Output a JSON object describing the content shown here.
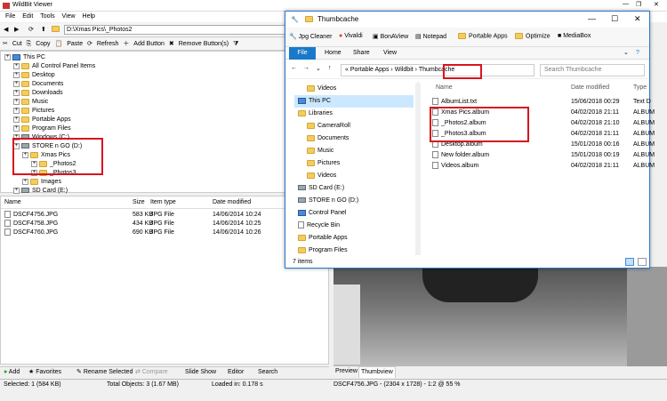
{
  "wildbit": {
    "title": "WildBit Viewer",
    "menu": [
      "File",
      "Edit",
      "Tools",
      "View",
      "Help"
    ],
    "address": "D:\\Xmas Pics\\_Photos2",
    "toolbar": [
      "Cut",
      "Copy",
      "Paste",
      "Refresh",
      "Add Button",
      "Remove Button(s)"
    ],
    "tree": [
      {
        "label": "This PC",
        "indent": 0,
        "icon": "pc"
      },
      {
        "label": "All Control Panel Items",
        "indent": 1,
        "icon": "folder"
      },
      {
        "label": "Desktop",
        "indent": 1,
        "icon": "folder"
      },
      {
        "label": "Documents",
        "indent": 1,
        "icon": "folder"
      },
      {
        "label": "Downloads",
        "indent": 1,
        "icon": "folder"
      },
      {
        "label": "Music",
        "indent": 1,
        "icon": "folder"
      },
      {
        "label": "Pictures",
        "indent": 1,
        "icon": "folder"
      },
      {
        "label": "Portable Apps",
        "indent": 1,
        "icon": "folder"
      },
      {
        "label": "Program Files",
        "indent": 1,
        "icon": "folder"
      },
      {
        "label": "Windows (C:)",
        "indent": 1,
        "icon": "drive"
      },
      {
        "label": "STORE n GO (D:)",
        "indent": 1,
        "icon": "drive"
      },
      {
        "label": "Xmas Pics",
        "indent": 2,
        "icon": "folder"
      },
      {
        "label": "_Photos2",
        "indent": 3,
        "icon": "folder"
      },
      {
        "label": "_Photos3",
        "indent": 3,
        "icon": "folder"
      },
      {
        "label": "Images",
        "indent": 2,
        "icon": "folder"
      },
      {
        "label": "SD Card (E:)",
        "indent": 1,
        "icon": "drive"
      }
    ],
    "columns": [
      "Name",
      "Size",
      "Item type",
      "Date modified"
    ],
    "files": [
      {
        "name": "DSCF4756.JPG",
        "size": "583 KB",
        "type": "JPG File",
        "date": "14/06/2014 10:24"
      },
      {
        "name": "DSCF4758.JPG",
        "size": "434 KB",
        "type": "JPG File",
        "date": "14/06/2014 10:25"
      },
      {
        "name": "DSCF4760.JPG",
        "size": "690 KB",
        "type": "JPG File",
        "date": "14/06/2014 10:26"
      }
    ],
    "bottom_buttons": [
      "Add",
      "Favorites",
      "Rename Selected",
      "Compare",
      "Slide Show",
      "Editor",
      "Search"
    ],
    "preview_tabs": [
      "Preview",
      "Thumbview"
    ],
    "status": {
      "selected": "Selected: 1 (584 KB)",
      "total": "Total Objects: 3 (1.67 MB)",
      "loaded": "Loaded in: 0.178 s",
      "image_info": "DSCF4756.JPG - (2304 x 1728) - 1:2 @ 55 %"
    }
  },
  "explorer": {
    "title": "Thumbcache",
    "favorites": [
      "Jpg Cleaner",
      "Vivaldi",
      "BonAView",
      "Notepad",
      "Portable Apps",
      "Optimize",
      "MediaBox"
    ],
    "tabs": [
      "File",
      "Home",
      "Share",
      "View"
    ],
    "breadcrumb": [
      "Portable Apps",
      "Wildbit",
      "Thumbcache"
    ],
    "search_placeholder": "Search Thumbcache",
    "nav": [
      {
        "label": "Videos",
        "indent": 1
      },
      {
        "label": "This PC",
        "indent": 0
      },
      {
        "label": "Libraries",
        "indent": 0
      },
      {
        "label": "CameraRoll",
        "indent": 1
      },
      {
        "label": "Documents",
        "indent": 1
      },
      {
        "label": "Music",
        "indent": 1
      },
      {
        "label": "Pictures",
        "indent": 1
      },
      {
        "label": "Videos",
        "indent": 1
      },
      {
        "label": "SD Card (E:)",
        "indent": 0
      },
      {
        "label": "STORE n GO (D:)",
        "indent": 0
      },
      {
        "label": "Control Panel",
        "indent": 0
      },
      {
        "label": "Recycle Bin",
        "indent": 0
      },
      {
        "label": "Portable Apps",
        "indent": 0
      },
      {
        "label": "Program Files",
        "indent": 0
      }
    ],
    "columns": [
      "Name",
      "Date modified",
      "Type"
    ],
    "files": [
      {
        "name": "AlbumList.txt",
        "date": "15/06/2018 00:29",
        "type": "Text D"
      },
      {
        "name": "Xmas Pics.album",
        "date": "04/02/2018 21:11",
        "type": "ALBUM"
      },
      {
        "name": "_Photos2.album",
        "date": "04/02/2018 21:10",
        "type": "ALBUM"
      },
      {
        "name": "_Photos3.album",
        "date": "04/02/2018 21:11",
        "type": "ALBUM"
      },
      {
        "name": "Desktop.album",
        "date": "15/01/2018 00:16",
        "type": "ALBUM"
      },
      {
        "name": "New folder.album",
        "date": "15/01/2018 00:19",
        "type": "ALBUM"
      },
      {
        "name": "Videos.album",
        "date": "04/02/2018 21:11",
        "type": "ALBUM"
      }
    ],
    "status": "7 items"
  },
  "accent": "#d8141d"
}
